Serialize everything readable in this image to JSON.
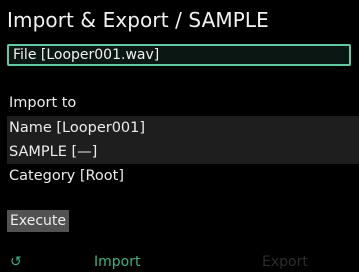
{
  "header": {
    "title": "Import & Export / SAMPLE"
  },
  "file": {
    "value": "File [Looper001.wav]"
  },
  "form": {
    "import_to_label": "Import to",
    "rows": [
      {
        "text": "Name [Looper001]"
      },
      {
        "text": "SAMPLE [—]"
      },
      {
        "text": "Category [Root]"
      }
    ]
  },
  "actions": {
    "execute_label": "Execute"
  },
  "footer": {
    "cycle_icon": "↺",
    "import_label": "Import",
    "export_label": "Export"
  },
  "colors": {
    "accent": "#3fb08a",
    "field_border": "#62c9a2",
    "row_highlight": "#1e1e1e",
    "button_bg": "#525252",
    "inactive_tab": "#2d2d2d"
  }
}
